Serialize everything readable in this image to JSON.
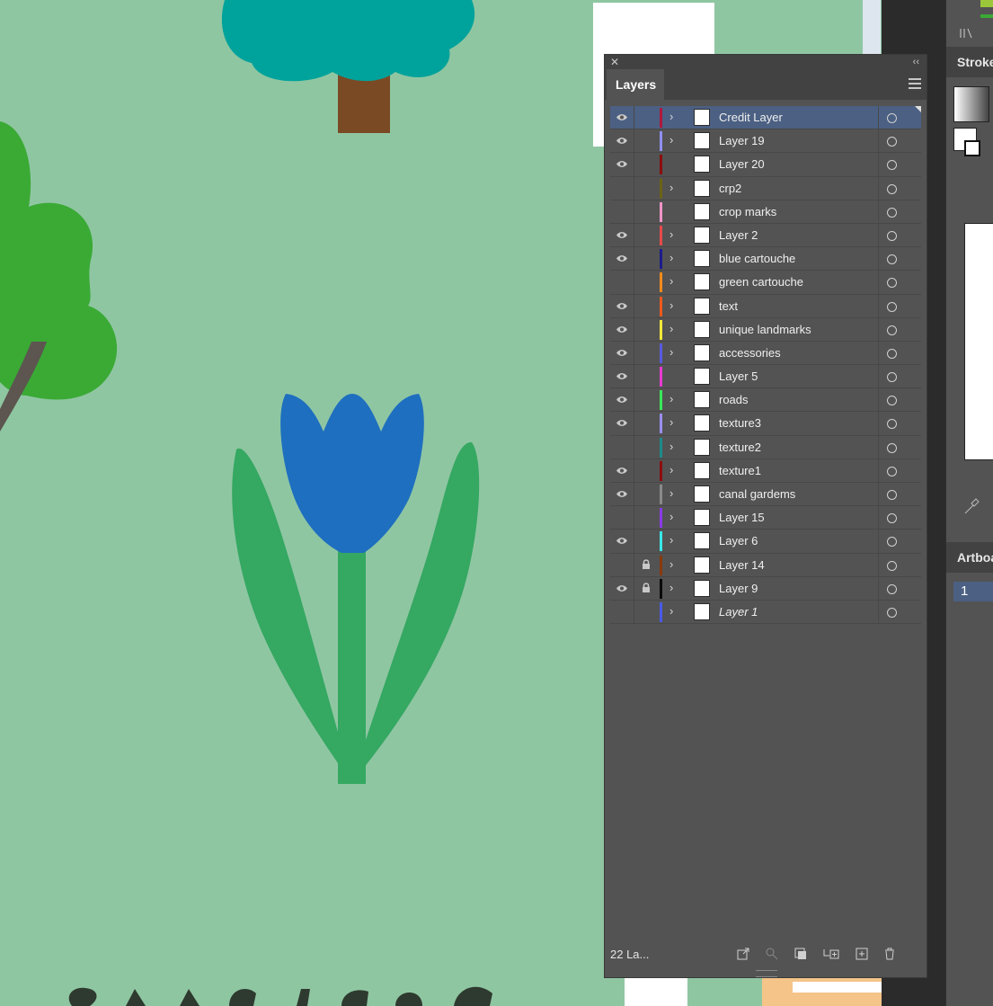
{
  "panel": {
    "title": "Layers",
    "layer_count": "22 La...",
    "layers": [
      {
        "name": "Credit Layer",
        "visible": true,
        "locked": false,
        "expandable": true,
        "color": "#b0183c",
        "selected": true,
        "italic": false
      },
      {
        "name": "Layer 19",
        "visible": true,
        "locked": false,
        "expandable": true,
        "color": "#8f8ff0",
        "selected": false,
        "italic": false
      },
      {
        "name": "Layer 20",
        "visible": true,
        "locked": false,
        "expandable": false,
        "color": "#8b0e0e",
        "selected": false,
        "italic": false
      },
      {
        "name": "crp2",
        "visible": false,
        "locked": false,
        "expandable": true,
        "color": "#6b6315",
        "selected": false,
        "italic": false
      },
      {
        "name": "crop marks",
        "visible": false,
        "locked": false,
        "expandable": false,
        "color": "#f095c8",
        "selected": false,
        "italic": false
      },
      {
        "name": "Layer 2",
        "visible": true,
        "locked": false,
        "expandable": true,
        "color": "#e84a4a",
        "selected": false,
        "italic": false
      },
      {
        "name": "blue cartouche",
        "visible": true,
        "locked": false,
        "expandable": true,
        "color": "#1c1c8a",
        "selected": false,
        "italic": false
      },
      {
        "name": "green cartouche",
        "visible": false,
        "locked": false,
        "expandable": true,
        "color": "#f28a1c",
        "selected": false,
        "italic": false
      },
      {
        "name": "text",
        "visible": true,
        "locked": false,
        "expandable": true,
        "color": "#f05a1c",
        "selected": false,
        "italic": false
      },
      {
        "name": "unique landmarks",
        "visible": true,
        "locked": false,
        "expandable": true,
        "color": "#f2e83a",
        "selected": false,
        "italic": false
      },
      {
        "name": "accessories",
        "visible": true,
        "locked": false,
        "expandable": true,
        "color": "#5a5ae0",
        "selected": false,
        "italic": false
      },
      {
        "name": "Layer 5",
        "visible": true,
        "locked": false,
        "expandable": false,
        "color": "#e83ad0",
        "selected": false,
        "italic": false
      },
      {
        "name": "roads",
        "visible": true,
        "locked": false,
        "expandable": true,
        "color": "#3ae85a",
        "selected": false,
        "italic": false
      },
      {
        "name": "texture3",
        "visible": true,
        "locked": false,
        "expandable": true,
        "color": "#9a8ef0",
        "selected": false,
        "italic": false
      },
      {
        "name": "texture2",
        "visible": false,
        "locked": false,
        "expandable": true,
        "color": "#1c8a8a",
        "selected": false,
        "italic": false
      },
      {
        "name": "texture1",
        "visible": true,
        "locked": false,
        "expandable": true,
        "color": "#8b0e0e",
        "selected": false,
        "italic": false
      },
      {
        "name": "canal gardems",
        "visible": true,
        "locked": false,
        "expandable": true,
        "color": "#8a8a8a",
        "selected": false,
        "italic": false
      },
      {
        "name": "Layer 15",
        "visible": false,
        "locked": false,
        "expandable": true,
        "color": "#8a3ae8",
        "selected": false,
        "italic": false
      },
      {
        "name": "Layer 6",
        "visible": true,
        "locked": false,
        "expandable": true,
        "color": "#3ae8e8",
        "selected": false,
        "italic": false
      },
      {
        "name": "Layer 14",
        "visible": false,
        "locked": true,
        "expandable": true,
        "color": "#8a3a0e",
        "selected": false,
        "italic": false
      },
      {
        "name": "Layer 9",
        "visible": true,
        "locked": true,
        "expandable": true,
        "color": "#0a0a0a",
        "selected": false,
        "italic": false
      },
      {
        "name": "Layer 1",
        "visible": false,
        "locked": false,
        "expandable": true,
        "color": "#4a5ae8",
        "selected": false,
        "italic": true
      }
    ],
    "footer_icons": [
      "export-icon",
      "locate-object-icon",
      "make-clipping-mask-icon",
      "create-sublayer-icon",
      "new-layer-icon",
      "delete-layer-icon"
    ]
  },
  "right_panels": {
    "stroke_label": "Stroke",
    "artboards_label": "Artboards",
    "artboard_number": "1"
  },
  "colors": {
    "canvas_bg": "#8fc6a2",
    "tulip_blue": "#1e6fbf",
    "stem_green": "#35a862",
    "tree_teal": "#00a39b",
    "tree_green": "#3aaa35",
    "trunk_brown": "#7a4a25",
    "selection_blue": "#4b6083"
  }
}
